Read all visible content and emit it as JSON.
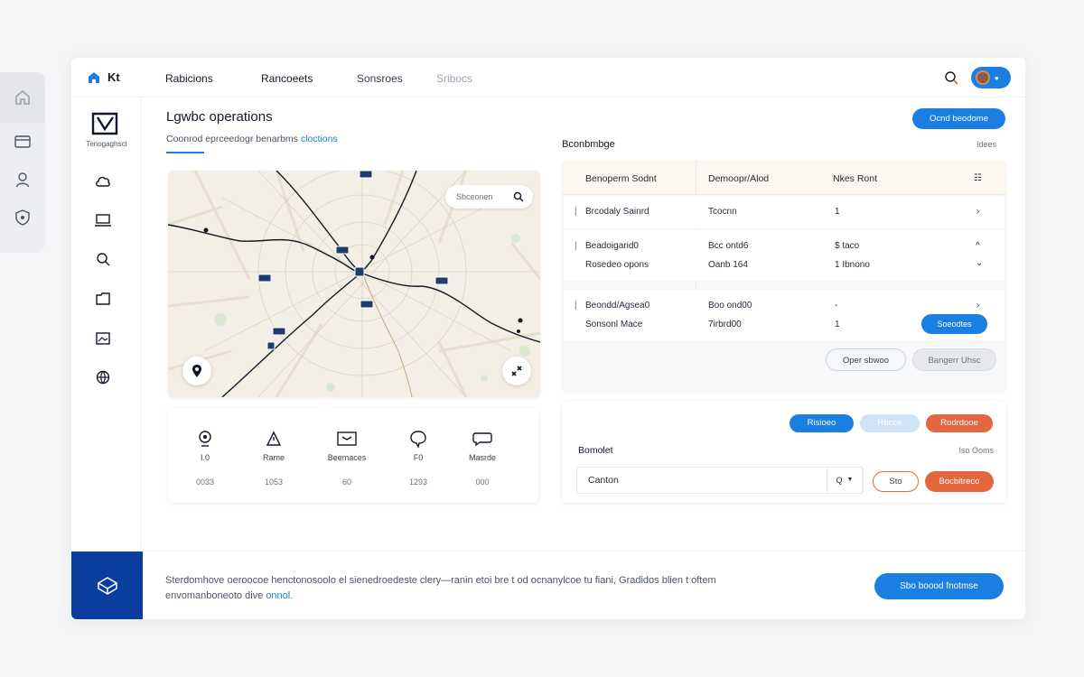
{
  "app": {
    "brand": "Kt",
    "nav": [
      "Rabicions",
      "Rancoeets",
      "Sonsroes",
      "Sribocs"
    ]
  },
  "sidebar": {
    "logo_text": "Tenogaghsct",
    "icons": [
      "cloud-icon",
      "device-icon",
      "search-icon",
      "folder-icon",
      "image-icon",
      "globe-icon"
    ]
  },
  "outer_rail": {
    "icons": [
      "home-icon",
      "card-icon",
      "user-icon",
      "shield-icon"
    ]
  },
  "main": {
    "title": "Lgwbc operations",
    "subtitle": "Coonrod eprceedogr benarbms",
    "subtitle_link": "cloctions"
  },
  "map": {
    "search_placeholder": "Sbceonen",
    "markers": 10
  },
  "stats": [
    {
      "icon": "location-pin-icon",
      "label": "I.0",
      "value": "0033"
    },
    {
      "icon": "warning-icon",
      "label": "Rame",
      "value": "1053"
    },
    {
      "icon": "inbox-icon",
      "label": "Beemaces",
      "value": "60"
    },
    {
      "icon": "chat-bubble-icon",
      "label": "F0",
      "value": "1293"
    },
    {
      "icon": "message-icon",
      "label": "Masrde",
      "value": "000"
    }
  ],
  "table_section": {
    "title": "Bconbmbge",
    "meta": "Idees",
    "primary_button": "Ocnd beodome",
    "columns": [
      "Benoperm Sodnt",
      "Demoopr/Alod",
      "Nkes Ront"
    ],
    "rows": [
      {
        "name": "Brcodaly Sainrd",
        "detail": "Tcocnn",
        "value": "1",
        "action": "›"
      },
      {
        "name": "Beadoigarid0",
        "detail": "Bcc ontd6",
        "value": "$ taco",
        "action": "^"
      },
      {
        "name": "Rosedeo opons",
        "detail": "Oanb 164",
        "value": "1 Ibnono",
        "action": "⌄"
      },
      {
        "name": "Beondd/Agsea0",
        "detail": "Boo ond00",
        "value": "-",
        "action": "›"
      },
      {
        "name": "Sonsonl Mace",
        "detail": "7irbrd00",
        "value": "1",
        "action_button": "Soeodtes"
      }
    ],
    "button_outline": "Oper sbwoo",
    "button_muted": "Bangerr Uhsc"
  },
  "filter_panel": {
    "btn_blue": "Risioeo",
    "btn_light": "Rbcce",
    "btn_red": "Rodrdooe",
    "title": "Bomolet",
    "meta": "Iso Ooms",
    "input_value": "Canton",
    "select_value": "Q",
    "btn_outline": "Sto",
    "btn_red2": "Bocbitreco"
  },
  "footer": {
    "text": "Sterdomhove oeroocoe henctonosoolo el sienedroedeste clery―ranin etoi bre t od ocnanylcoe tu fiani, Gradidos blien t oftem envomanboneoto dive",
    "link": "onnol.",
    "button": "Sbo boood fnotmse"
  },
  "colors": {
    "accent": "#1a7fe0",
    "danger": "#e2673e",
    "navy": "#0a3d9e"
  }
}
